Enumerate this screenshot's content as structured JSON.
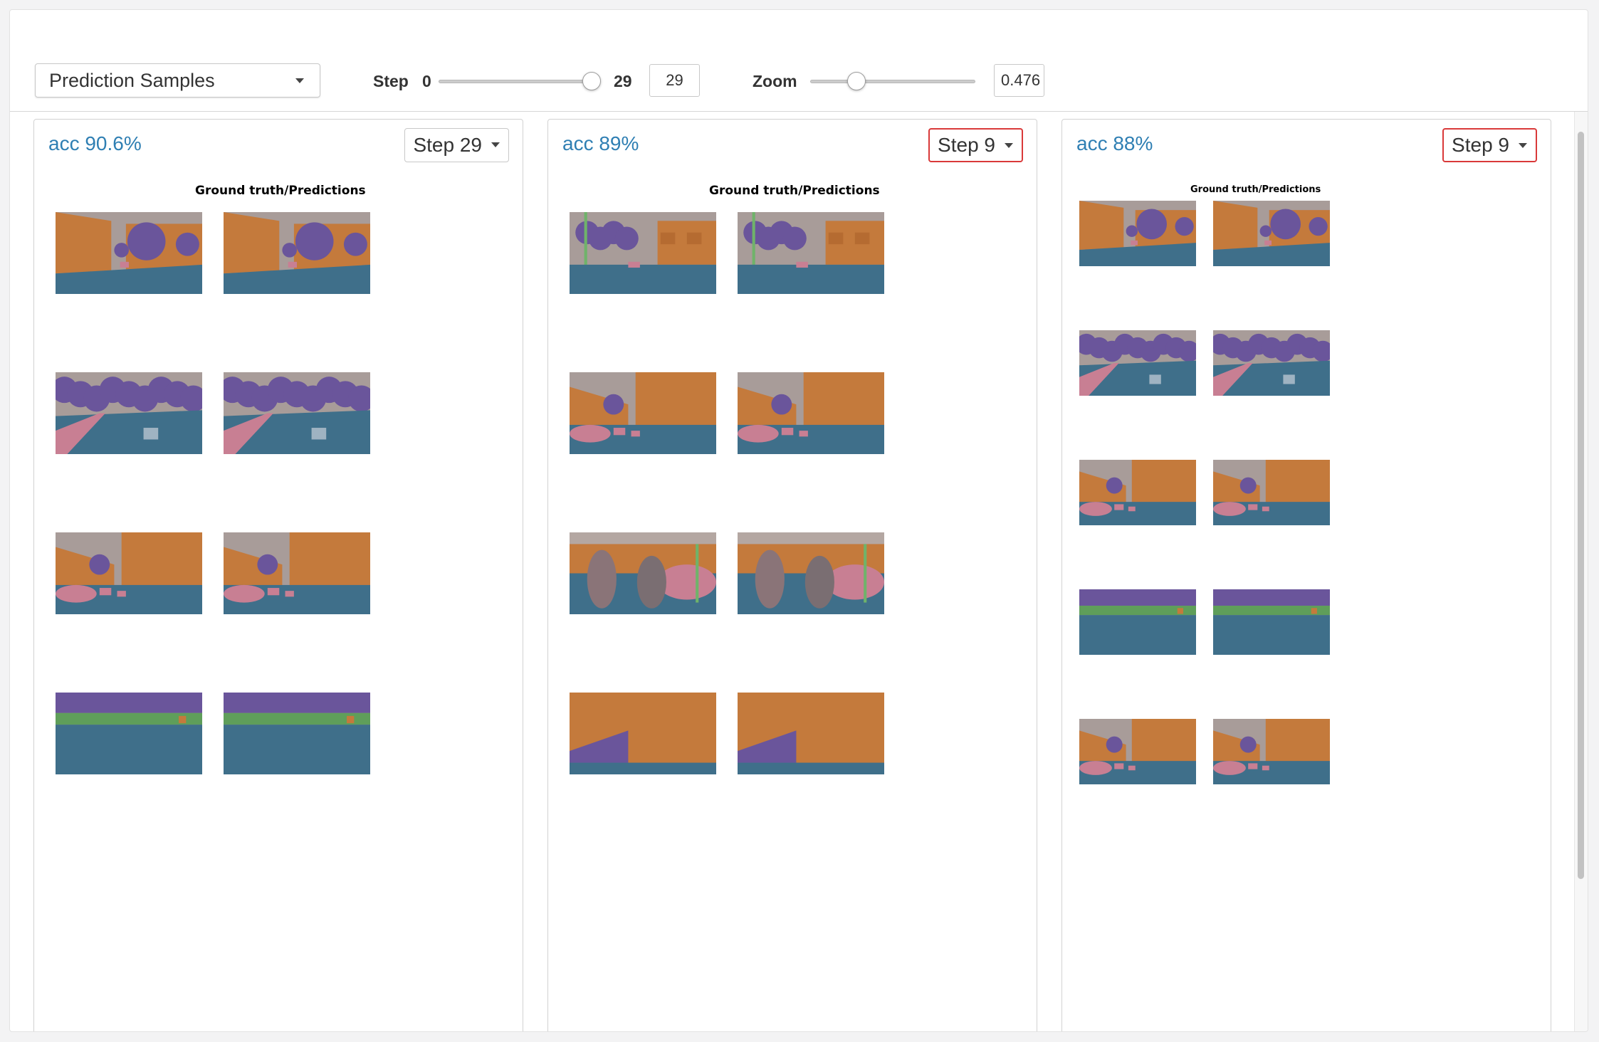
{
  "toolbar": {
    "panel_select": "Prediction Samples",
    "step_label": "Step",
    "step_min": "0",
    "step_max": "29",
    "step_value": "29",
    "zoom_label": "Zoom",
    "zoom_value": "0.476"
  },
  "panels": [
    {
      "acc": "acc 90.6%",
      "step": "Step 29",
      "title": "Ground truth/Predictions"
    },
    {
      "acc": "acc 89%",
      "step": "Step 9",
      "title": "Ground truth/Predictions"
    },
    {
      "acc": "acc 88%",
      "step": "Step 9",
      "title": "Ground truth/Predictions"
    }
  ],
  "colors": {
    "accent_link": "#2f7fb3",
    "highlight_border": "#d93939",
    "building": "#c47a3c",
    "vegetation": "#6a559b",
    "road": "#3f6f8a",
    "sky": "#a89c99",
    "car": "#c87f93"
  },
  "icons": [
    "caret-down-icon",
    "slider-thumb"
  ],
  "scenes": [
    "city-trees",
    "road-trees",
    "building-cars",
    "grass-road",
    "street-pillar",
    "people-street",
    "awning-street"
  ]
}
